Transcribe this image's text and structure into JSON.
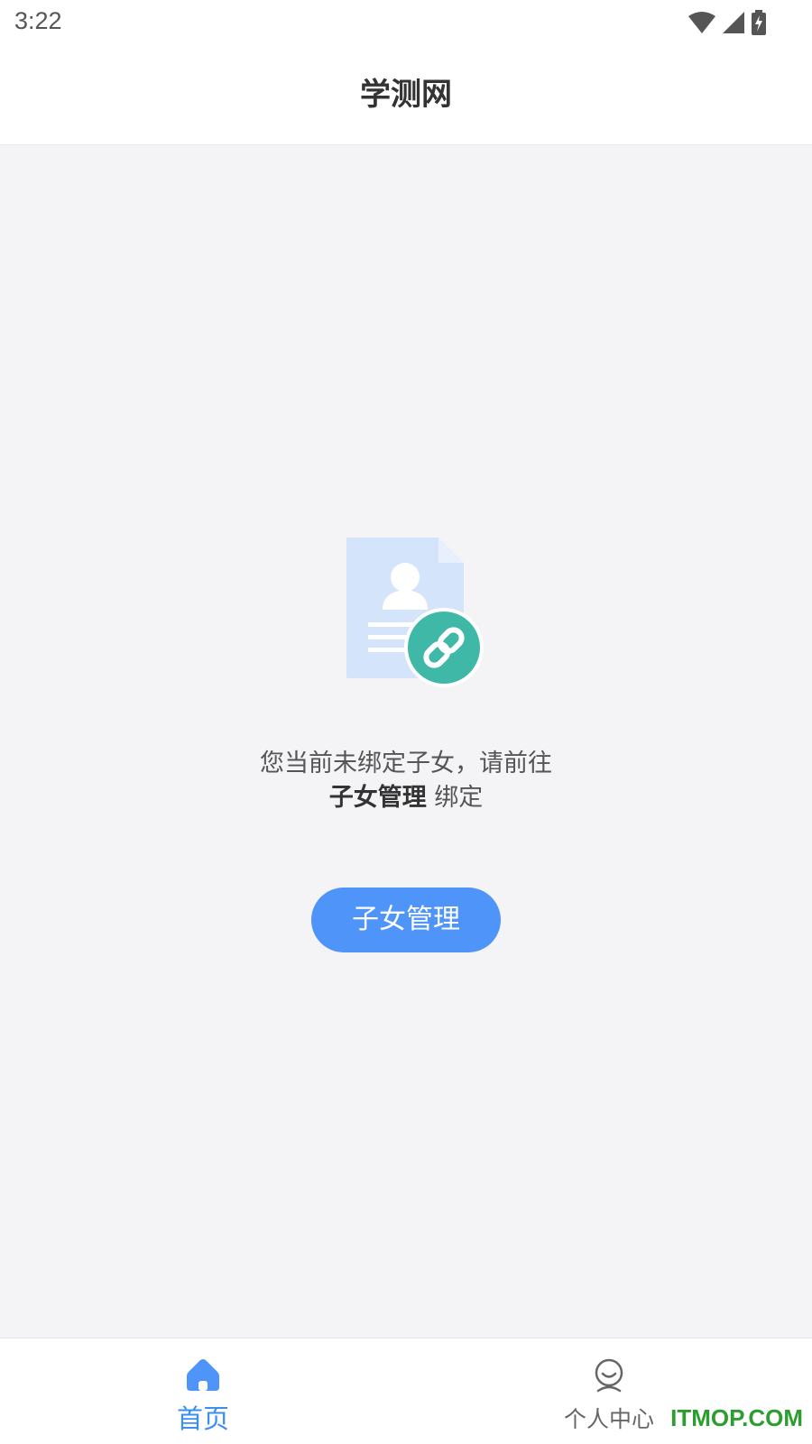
{
  "status_bar": {
    "time": "3:22",
    "icons": [
      "wifi-icon",
      "signal-icon",
      "battery-charging-icon"
    ]
  },
  "header": {
    "title": "学测网"
  },
  "empty_state": {
    "illustration": "document-link-icon",
    "message_line1": "您当前未绑定子女，请前往",
    "message_strong": "子女管理",
    "message_suffix": " 绑定",
    "button_label": "子女管理"
  },
  "tabbar": {
    "active": "home",
    "tabs": [
      {
        "id": "home",
        "label": "首页",
        "icon": "home-icon"
      },
      {
        "id": "profile",
        "label": "个人中心",
        "icon": "user-icon"
      }
    ]
  },
  "watermark": "ITMOP.COM",
  "colors": {
    "accent": "#4f94f8",
    "tab_active": "#3a8ff5",
    "link_badge": "#3fb8a8",
    "background": "#f4f4f6"
  }
}
